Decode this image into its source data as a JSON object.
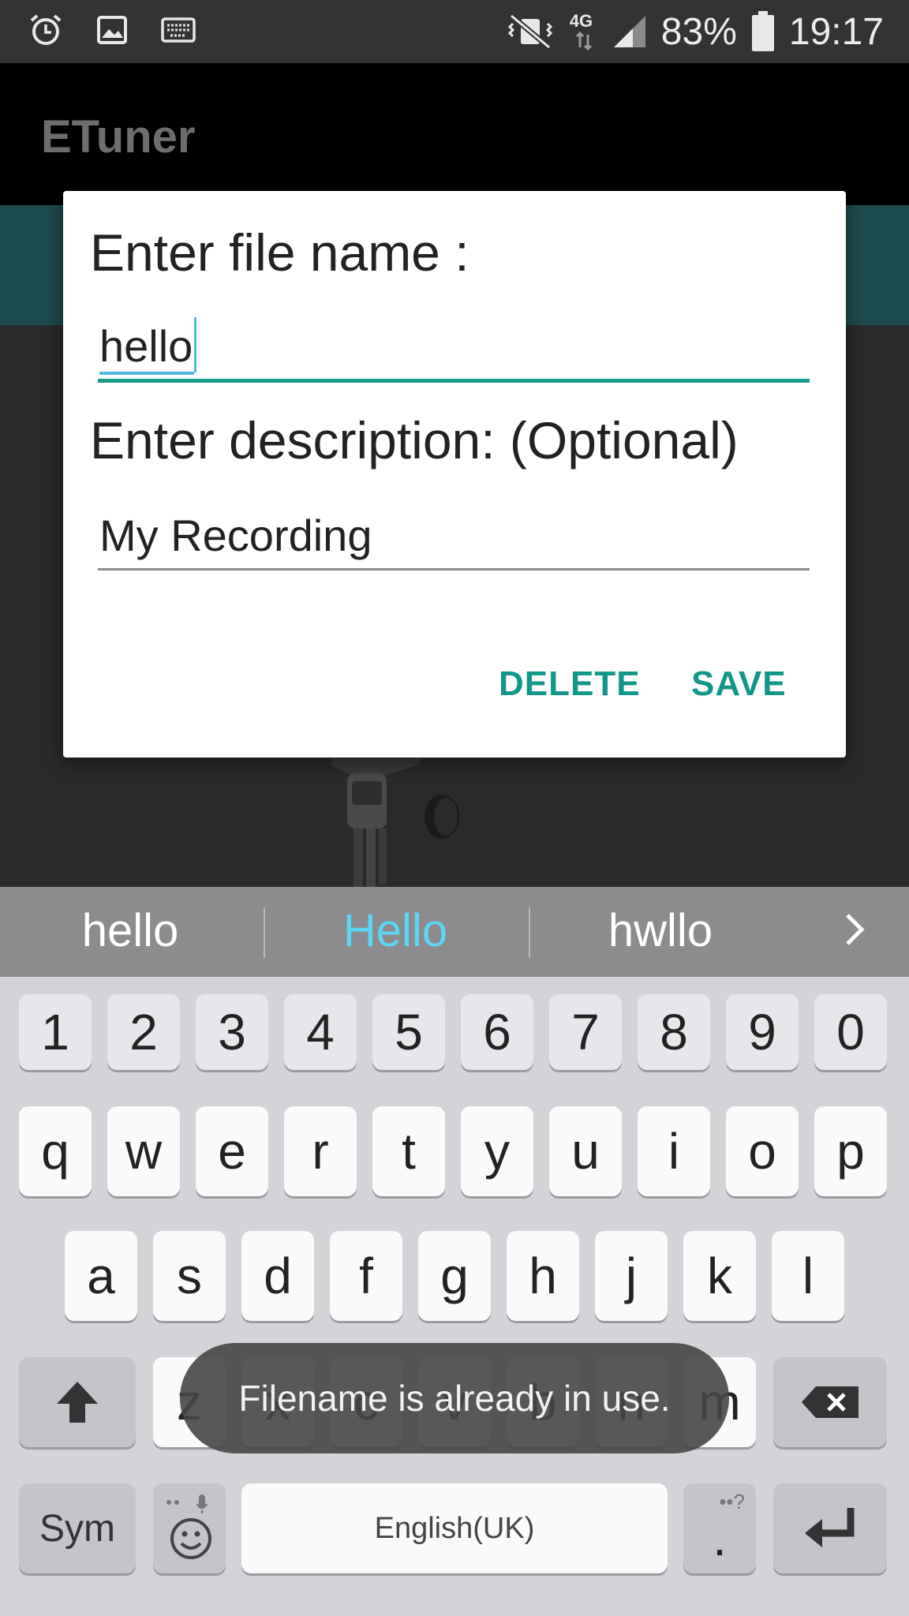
{
  "status_bar": {
    "battery": "83%",
    "time": "19:17",
    "network": "4G",
    "icons": [
      "alarm-icon",
      "image-icon",
      "keyboard-icon",
      "mute-vibrate-icon",
      "signal-icon",
      "battery-icon"
    ]
  },
  "app": {
    "title": "ETuner"
  },
  "dialog": {
    "filename_label": "Enter file name :",
    "filename_value": "hello",
    "description_label": "Enter description: (Optional)",
    "description_value": "My Recording",
    "delete_label": "DELETE",
    "save_label": "SAVE",
    "accent_color": "#13968a"
  },
  "suggestions": [
    "hello",
    "Hello",
    "hwllo"
  ],
  "keyboard": {
    "number_row": [
      "1",
      "2",
      "3",
      "4",
      "5",
      "6",
      "7",
      "8",
      "9",
      "0"
    ],
    "row1": [
      "q",
      "w",
      "e",
      "r",
      "t",
      "y",
      "u",
      "i",
      "o",
      "p"
    ],
    "row2": [
      "a",
      "s",
      "d",
      "f",
      "g",
      "h",
      "j",
      "k",
      "l"
    ],
    "row3": [
      "z",
      "x",
      "c",
      "v",
      "b",
      "n",
      "m"
    ],
    "sym_label": "Sym",
    "space_label": "English(UK)",
    "period_label": "."
  },
  "toast": {
    "message": "Filename is already in use."
  }
}
